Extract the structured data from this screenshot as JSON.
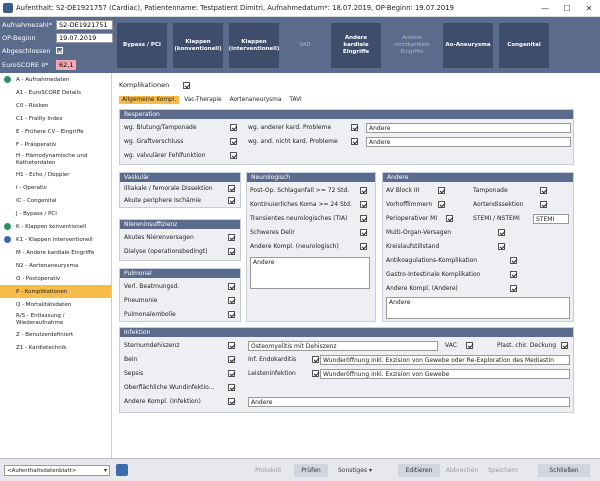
{
  "window": {
    "title": "Aufenthalt: S2-DE1921757 (Cardiac), Patientenname: Testpatient Dimitri, Aufnahmedatum*: 18.07.2019, OP-Beginn: 19.07.2019",
    "minimize": "—",
    "maximize": "☐",
    "close": "✕"
  },
  "header": {
    "aufnahmezahl_label": "Aufnahmezahl*",
    "aufnahmezahl_value": "S2-DE1921751",
    "op_beginn_label": "OP-Beginn",
    "op_beginn_value": "19.07.2019",
    "abgeschlossen_label": "Abgeschlossen",
    "euroscore_label": "EuroSCORE II*",
    "euroscore_value": "62,1"
  },
  "tiles": [
    "Bypass / PCI",
    "Klappen (konventionell)",
    "Klappen (interventionell)",
    "VAD",
    "Andere kardiale Eingriffe",
    "Andere nichtkardiale Eingriffe",
    "Ao-Aneurysma",
    "Congenital"
  ],
  "sidebar": [
    {
      "label": "A - Aufnahmedaten",
      "status": "green"
    },
    {
      "label": "A1 - EuroSCORE Details",
      "status": "none"
    },
    {
      "label": "C0 - Risiken",
      "status": "none"
    },
    {
      "label": "C1 - Frailty Index",
      "status": "none"
    },
    {
      "label": "E - Frühere CV - Eingriffe",
      "status": "none"
    },
    {
      "label": "F - Präoperativ",
      "status": "none"
    },
    {
      "label": "H - Hämodynamische und Katheterdaten",
      "status": "none"
    },
    {
      "label": "H1 - Echo / Doppler",
      "status": "none"
    },
    {
      "label": "I - Operativ",
      "status": "none"
    },
    {
      "label": "IC - Congenital",
      "status": "none"
    },
    {
      "label": "J - Bypass / PCI",
      "status": "none"
    },
    {
      "label": "K - Klappen konventionell",
      "status": "green"
    },
    {
      "label": "K1 - Klappen interventionell",
      "status": "blue"
    },
    {
      "label": "M - Andere kardiale Eingriffe",
      "status": "none"
    },
    {
      "label": "N2 - Aortenaneurysma",
      "status": "none"
    },
    {
      "label": "O - Postoperativ",
      "status": "none"
    },
    {
      "label": "P - Komplikationen",
      "status": "none",
      "active": true
    },
    {
      "label": "Q - Mortalitätsdaten",
      "status": "none"
    },
    {
      "label": "R/S - Entlassung / Wiederaufnahme",
      "status": "none"
    },
    {
      "label": "Z - Benutzerdefiniert",
      "status": "none"
    },
    {
      "label": "Z1 - Kardiotechnik",
      "status": "none"
    }
  ],
  "main": {
    "komplikationen_label": "Komplikationen",
    "tabs": [
      "Allgemeine Kompl.",
      "Vac-Therapie",
      "Aortenaneurysma",
      "TAVI"
    ],
    "resperation": {
      "title": "Resperation",
      "blutung": "wg. Blutung/Tamponade",
      "graft": "wg. Graftverschluss",
      "valvular": "wg. valvulärer Fehlfunktion",
      "andere_kard": "wg. anderer kard. Probleme",
      "andere_kard_value": "Andere",
      "nicht_kard": "wg. and. nicht kard. Probleme",
      "nicht_kard_value": "Andere"
    },
    "vaskular": {
      "title": "Vaskulär",
      "iliakale": "Illiakale / femorale Dissektion",
      "ischamie": "Akute periphere Ischämie"
    },
    "niere": {
      "title": "Niereninsuffizienz",
      "akut": "Akutes Nierenversagen",
      "dialyse": "Dialyse (operationsbedingt)"
    },
    "pulmonal": {
      "title": "Pulmonal",
      "beatmung": "Verl. Beatmungsd.",
      "pneumonie": "Pneumonie",
      "embolie": "Pulmonalembolie"
    },
    "neurologisch": {
      "title": "Neurologisch",
      "schlaganfall": "Post-Op. Schlaganfall >= 72 Std.",
      "koma": "Kontinuierliches Koma >= 24 Std.",
      "transient": "Transientes neurologisches (TIA)",
      "delir": "Schweres Delir",
      "andere": "Andere  Kompl. (neurologisch)",
      "andere_value": "Andere"
    },
    "andere": {
      "title": "Andere",
      "av_block": "AV Block III",
      "tamponade": "Tamponade",
      "vorhof": "Vorhofflimmern",
      "aorten": "Aortendissektion",
      "mi": "Perioperativer MI",
      "stemi_label": "STEMI / NSTEMI",
      "stemi_value": "STEMI",
      "multi": "Multi-Organ-Versagen",
      "kreislauf": "Kreislaufstillstand",
      "antikoag": "Antikoagulations-Komplikation",
      "gastro": "Gastro-Intestinale Komplikation",
      "andere_kompl": "Andere Kompl. (Andere)",
      "andere_value": "Andere"
    },
    "infektion": {
      "title": "Infektion",
      "sternum": "Sternumdehiszenz",
      "sternum_value": "Osteomyelitis mit Dehiszenz",
      "vac": "VAC",
      "plast": "Plast. chir. Deckung",
      "bein": "Bein",
      "endokarditis_label": "Inf. Endokarditis",
      "endokarditis_value": "Wunderöffnung inkl. Exzision von Gewebe oder Re-Exploration des Mediastin",
      "sepsis": "Sepsis",
      "leiste_label": "Leisteninfektion",
      "leiste_value": "Wunderöffnung inkl. Exzision von Gewebe",
      "oberflaechlich": "Oberflächliche  Wundinfektio...",
      "andere_inf": "Andere Kompl. (Infektion)",
      "andere_inf_value": "Andere"
    }
  },
  "bottom": {
    "selector": "<Aufenthaltsdatenblatt>",
    "protokoll": "Protokoll",
    "pruefen": "Prüfen",
    "sonstiges": "Sonstiges ▾",
    "editieren": "Editieren",
    "abbrechen": "Abbrechen",
    "speichern": "Speichern",
    "schliessen": "Schließen"
  }
}
